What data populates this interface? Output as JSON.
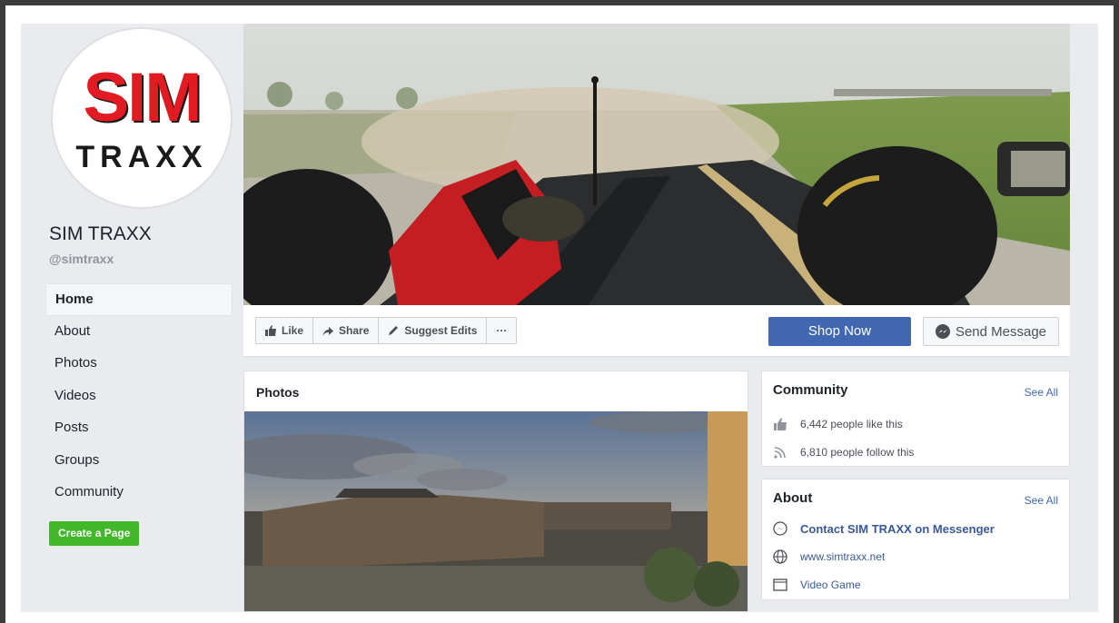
{
  "page": {
    "name": "SIM TRAXX",
    "handle": "@simtraxx",
    "logo": {
      "line1": "SIM",
      "line2": "TRAXX"
    }
  },
  "nav": {
    "items": [
      {
        "label": "Home"
      },
      {
        "label": "About"
      },
      {
        "label": "Photos"
      },
      {
        "label": "Videos"
      },
      {
        "label": "Posts"
      },
      {
        "label": "Groups"
      },
      {
        "label": "Community"
      }
    ],
    "create_page": "Create a Page"
  },
  "actions": {
    "like": "Like",
    "share": "Share",
    "suggest": "Suggest Edits",
    "more": "···",
    "shop": "Shop Now",
    "message": "Send Message"
  },
  "photos": {
    "title": "Photos"
  },
  "community": {
    "title": "Community",
    "see_all": "See All",
    "likes": "6,442 people like this",
    "follows": "6,810 people follow this"
  },
  "about": {
    "title": "About",
    "see_all": "See All",
    "messenger": "Contact SIM TRAXX on Messenger",
    "website": "www.simtraxx.net",
    "category": "Video Game"
  },
  "colors": {
    "brand_blue": "#4267b2",
    "green": "#42b72a",
    "logo_red": "#e21b23"
  }
}
